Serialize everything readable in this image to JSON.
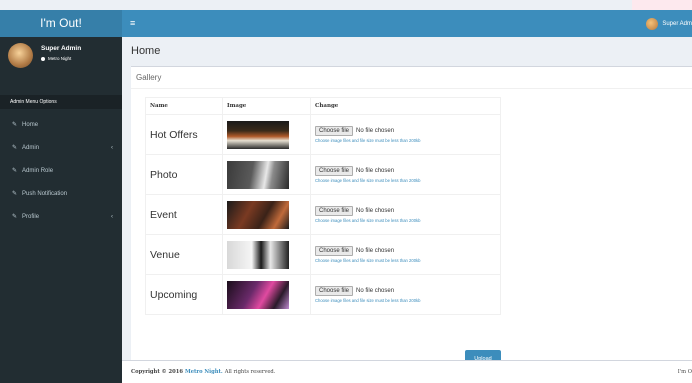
{
  "app": {
    "logo": "I'm Out!"
  },
  "topbar": {
    "menu_icon": "≡",
    "user_name": "Super Adm"
  },
  "user_panel": {
    "name": "Super Admin",
    "status": "Metro Night"
  },
  "sidebar": {
    "header": "Admin Menu Options",
    "items": [
      {
        "label": "Home",
        "has_caret": false
      },
      {
        "label": "Admin",
        "has_caret": true
      },
      {
        "label": "Admin Role",
        "has_caret": false
      },
      {
        "label": "Push Notification",
        "has_caret": false
      },
      {
        "label": "Profile",
        "has_caret": true
      }
    ]
  },
  "page": {
    "title": "Home"
  },
  "gallery": {
    "title": "Gallery",
    "columns": [
      "Name",
      "Image",
      "Change"
    ],
    "rows": [
      {
        "name": "Hot Offers",
        "file_button": "Choose file",
        "file_status": "No file chosen",
        "hint": "Choose image files and file size must be less than 200kb"
      },
      {
        "name": "Photo",
        "file_button": "Choose file",
        "file_status": "No file chosen",
        "hint": "Choose image files and file size must be less than 200kb"
      },
      {
        "name": "Event",
        "file_button": "Choose file",
        "file_status": "No file chosen",
        "hint": "Choose image files and file size must be less than 200kb"
      },
      {
        "name": "Venue",
        "file_button": "Choose file",
        "file_status": "No file chosen",
        "hint": "Choose image files and file size must be less than 200kb"
      },
      {
        "name": "Upcoming",
        "file_button": "Choose file",
        "file_status": "No file chosen",
        "hint": "Choose image files and file size must be less than 200kb"
      }
    ],
    "upload_label": "Upload"
  },
  "footer": {
    "copyright": "Copyright © 2016",
    "brand": "Metro Night.",
    "rights": "All rights reserved.",
    "right_text": "I'm O"
  },
  "colors": {
    "primary": "#3c8dbc",
    "logo_bg": "#367fa9",
    "sidebar_bg": "#222d32"
  }
}
